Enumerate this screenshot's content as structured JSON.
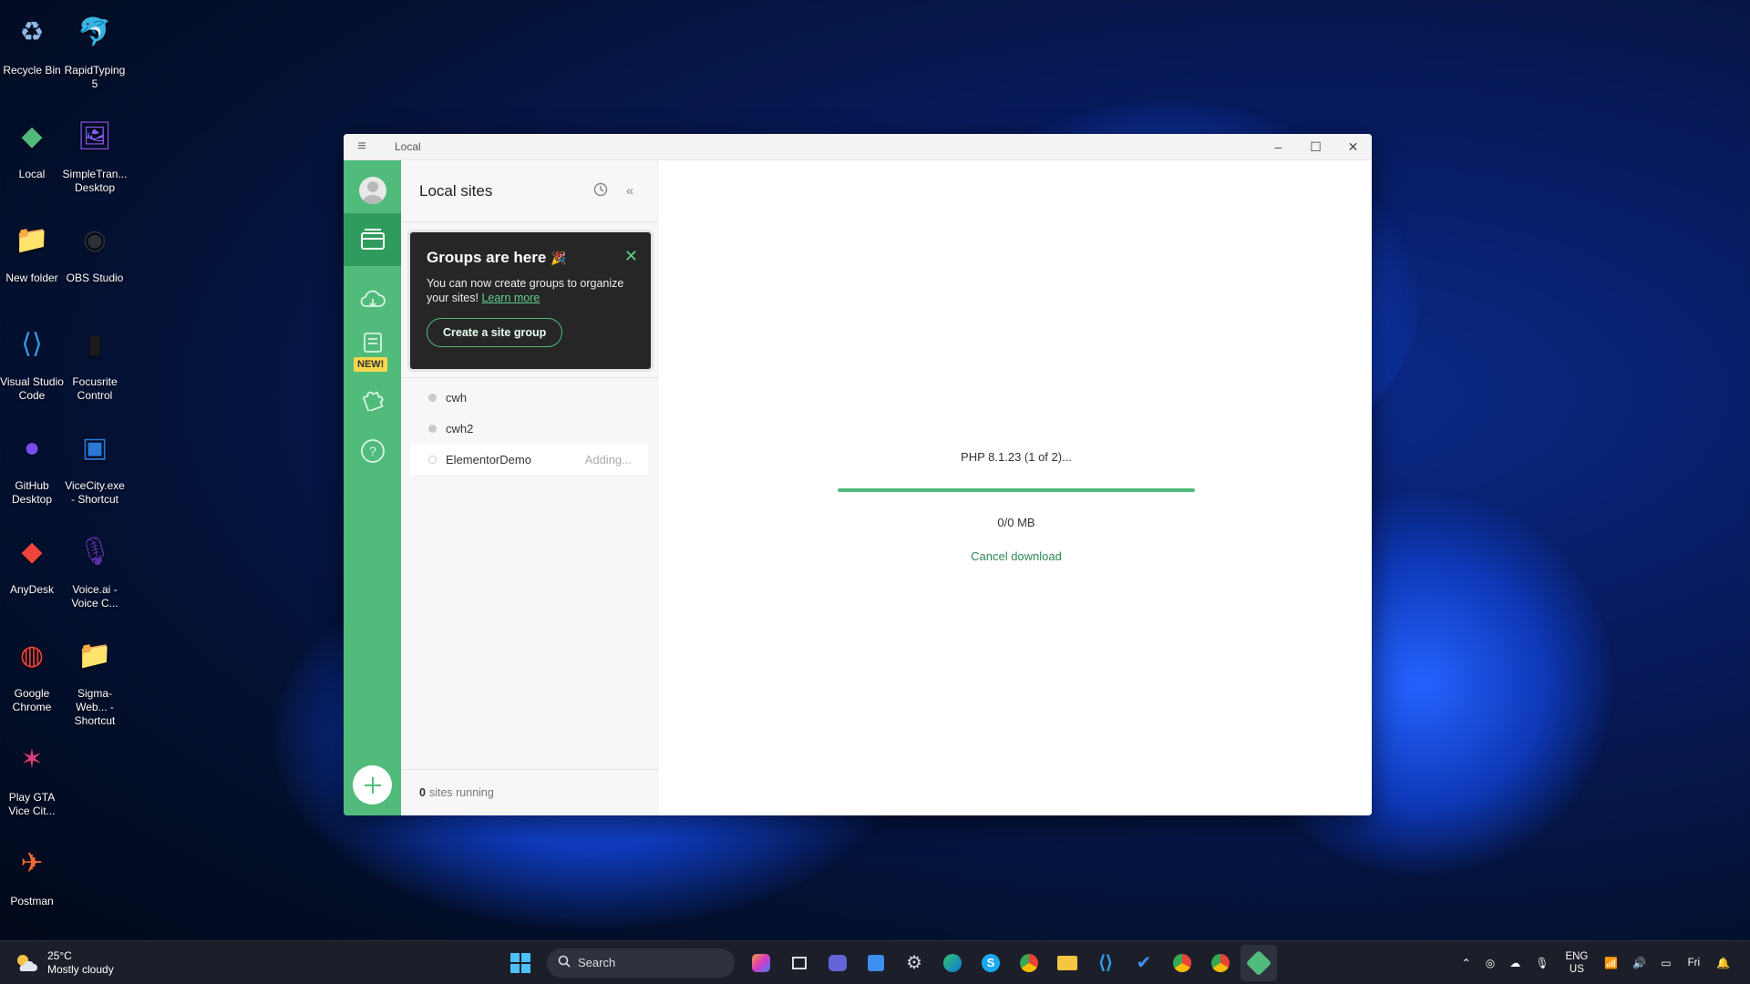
{
  "desktop": {
    "icons": [
      {
        "label": "Recycle Bin",
        "icon": "recycle-bin-icon"
      },
      {
        "label": "RapidTyping 5",
        "icon": "rapidtyping-icon"
      },
      {
        "label": "Local",
        "icon": "local-app-icon"
      },
      {
        "label": "SimpleTran... Desktop",
        "icon": "simpletransfer-icon"
      },
      {
        "label": "New folder",
        "icon": "folder-icon"
      },
      {
        "label": "OBS Studio",
        "icon": "obs-icon"
      },
      {
        "label": "Visual Studio Code",
        "icon": "vscode-icon"
      },
      {
        "label": "Focusrite Control",
        "icon": "focusrite-icon"
      },
      {
        "label": "GitHub Desktop",
        "icon": "github-icon"
      },
      {
        "label": "ViceCity.exe - Shortcut",
        "icon": "vicecity-exe-icon"
      },
      {
        "label": "AnyDesk",
        "icon": "anydesk-icon"
      },
      {
        "label": "Voice.ai - Voice C...",
        "icon": "voiceai-icon"
      },
      {
        "label": "Google Chrome",
        "icon": "chrome-icon"
      },
      {
        "label": "Sigma-Web... - Shortcut",
        "icon": "folder-icon"
      },
      {
        "label": "Play GTA Vice Cit...",
        "icon": "vicecity-icon"
      },
      {
        "label": "Postman",
        "icon": "postman-icon"
      }
    ]
  },
  "window": {
    "title": "Local",
    "minimize": "–",
    "maximize": "☐",
    "close": "✕"
  },
  "rail": {
    "new_badge": "NEW!"
  },
  "sidebar": {
    "title": "Local sites",
    "groups_card": {
      "heading": "Groups are here",
      "body": "You can now create groups to organize your sites!",
      "link": "Learn more",
      "button": "Create a site group"
    },
    "sites": [
      {
        "name": "cwh",
        "status": ""
      },
      {
        "name": "cwh2",
        "status": ""
      },
      {
        "name": "ElementorDemo",
        "status": "Adding..."
      }
    ],
    "footer_count": "0",
    "footer_text": "sites running"
  },
  "main": {
    "progress_label": "PHP 8.1.23 (1 of 2)...",
    "progress_value": 1.0,
    "size_label": "0/0 MB",
    "cancel": "Cancel download"
  },
  "taskbar": {
    "weather_temp": "25°C",
    "weather_desc": "Mostly cloudy",
    "search_placeholder": "Search",
    "lang_top": "ENG",
    "lang_bottom": "US",
    "clock_day": "Fri"
  },
  "colors": {
    "accent": "#51bb7b",
    "accent_dark": "#2f9c5e"
  }
}
